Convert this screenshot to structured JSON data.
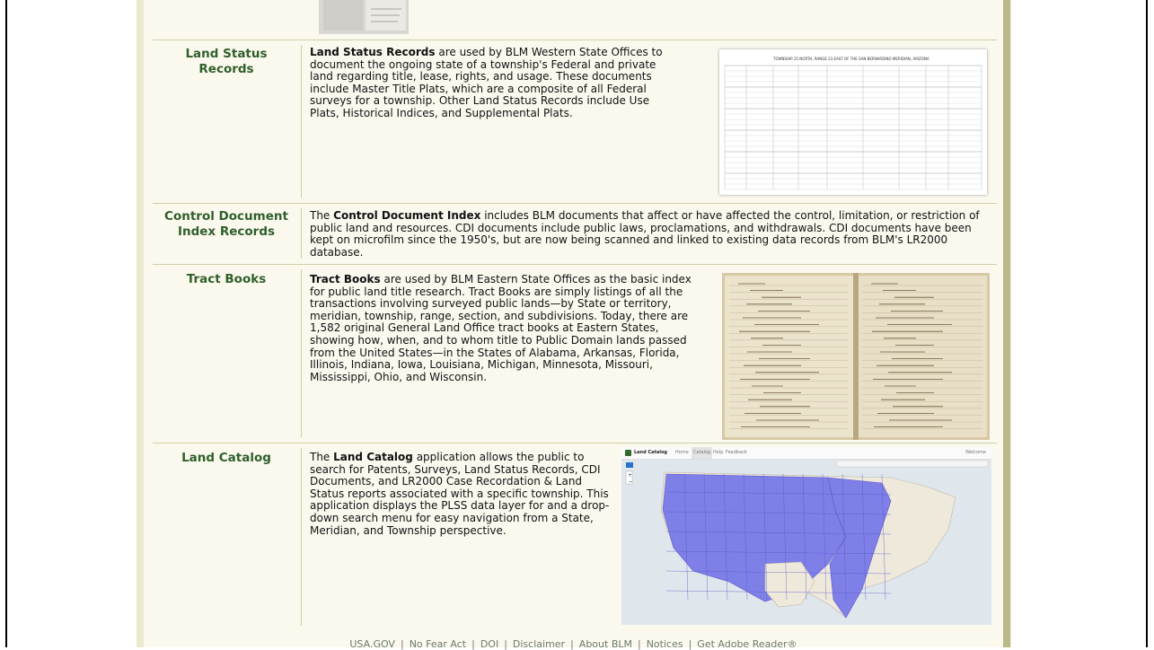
{
  "records": [
    {
      "label": "Land Status Records",
      "bold": "Land Status Records",
      "text": " are used by BLM Western State Offices to document the ongoing state of a township's Federal and private land regarding title, lease, rights, and usage. These documents include Master Title Plats, which are a composite of all Federal surveys for a township. Other Land Status Records include Use Plats, Historical Indices, and Supplemental Plats.",
      "image_caption": "TOWNSHIP 25 NORTH, RANGE 23 EAST OF THE SAN BERNARDINO MERIDIAN, ARIZONA"
    },
    {
      "label": "Control Document Index Records",
      "pre": "The ",
      "bold": "Control Document Index",
      "text": " includes BLM documents that affect or have affected the control, limitation, or restriction of public land and resources. CDI documents include public laws, proclamations, and withdrawals. CDI documents have been kept on microfilm since the 1950's, but are now being scanned and linked to existing data records from BLM's LR2000 database."
    },
    {
      "label": "Tract Books",
      "bold": "Tract Books",
      "text": " are used by BLM Eastern State Offices as the basic index for public land title research. Tract Books are simply listings of all the transactions involving surveyed public lands—by State or territory, meridian, township, range, section, and subdivisions. Today, there are 1,582 original General Land Office tract books at Eastern States, showing how, when, and to whom title to Public Domain lands passed from the United States—in the States of Alabama, Arkansas, Florida, Illinois, Indiana, Iowa, Louisiana, Michigan, Minnesota, Missouri, Mississippi, Ohio, and Wisconsin."
    },
    {
      "label": "Land Catalog",
      "pre": "The ",
      "bold": "Land Catalog",
      "text": " application allows the public to search for Patents, Surveys, Land Status Records, CDI Documents, and LR2000 Case Recordation & Land Status reports associated with a specific township. This application displays the PLSS data layer for and a drop-down search menu for easy navigation from a State, Meridian, and Township perspective.",
      "app_title": "Land Catalog",
      "app_tabs": [
        "Home",
        "Catalog",
        "Help",
        "Feedback"
      ],
      "app_right": "Welcome"
    }
  ],
  "footer": {
    "links": [
      "USA.GOV",
      "No Fear Act",
      "DOI",
      "Disclaimer",
      "About BLM",
      "Notices",
      "Get Adobe Reader®"
    ],
    "separator": "|"
  },
  "colors": {
    "label": "#2f5f2a",
    "map_states": "#7f7fe8",
    "border": "#b9b98a"
  }
}
